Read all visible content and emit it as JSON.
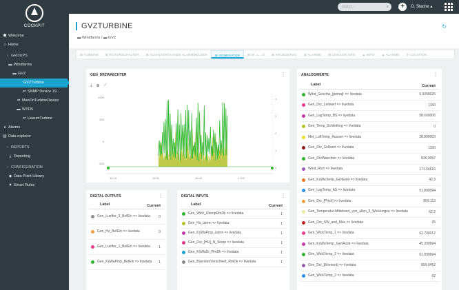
{
  "app": {
    "logo": "COCKPIT"
  },
  "sidebar": {
    "items": [
      {
        "label": "Welcome",
        "icon": "⬢",
        "indent": 2,
        "sep": false,
        "active": false
      },
      {
        "label": "Home",
        "icon": "⌂",
        "indent": 2,
        "sep": false,
        "active": false
      },
      {
        "label": "GROUPS",
        "icon": "›",
        "indent": 6,
        "sep": true,
        "active": false
      },
      {
        "label": "Windfarms",
        "icon": "▬",
        "indent": 10,
        "sep": false,
        "active": false
      },
      {
        "label": "GVZ",
        "icon": "▬",
        "indent": 16,
        "sep": false,
        "active": false
      },
      {
        "label": "GVZTurbine",
        "icon": "",
        "indent": 34,
        "sep": false,
        "active": true
      },
      {
        "label": "SNMP Device 19...",
        "icon": "⇌",
        "indent": 30,
        "sep": false,
        "active": false
      },
      {
        "label": "ManOnTurbineDevice",
        "icon": "⇌",
        "indent": 22,
        "sep": false,
        "active": false
      },
      {
        "label": "WTFN",
        "icon": "▬",
        "indent": 22,
        "sep": false,
        "active": false
      },
      {
        "label": "HasumTurbine",
        "icon": "⇌",
        "indent": 30,
        "sep": false,
        "active": false
      },
      {
        "label": "Alarms",
        "icon": "♦",
        "indent": 2,
        "sep": false,
        "active": false
      },
      {
        "label": "Data explorer",
        "icon": "▥",
        "indent": 2,
        "sep": false,
        "active": false
      },
      {
        "label": "REPORTS",
        "icon": "›",
        "indent": 6,
        "sep": true,
        "active": false
      },
      {
        "label": "Reporting",
        "icon": "⤓",
        "indent": 10,
        "sep": false,
        "active": false
      },
      {
        "label": "CONFIGURATION",
        "icon": "›",
        "indent": 6,
        "sep": true,
        "active": false
      },
      {
        "label": "Data Point Library",
        "icon": "◆",
        "indent": 10,
        "sep": false,
        "active": false
      },
      {
        "label": "Smart Rules",
        "icon": "✷",
        "indent": 10,
        "sep": false,
        "active": false
      }
    ]
  },
  "topbar": {
    "search_placeholder": "search...",
    "search_icon": "⌕",
    "add_icon": "+",
    "user": "O. Stache ▴",
    "colors": {
      "bar": "#2f3b40",
      "accent": "#19a3cf"
    }
  },
  "header": {
    "title": "GVZTURBINE",
    "crumb": "▬ Windfarms / ▬ GVZ",
    "refresh_icon": "↻"
  },
  "tabs": [
    "⊞ TURBINE",
    "⊞ ROTORSCHALTER",
    "⊞ SCHALTERSTANDE ALARMMELDER",
    "⊞ GENERATOR",
    "⊞ W...L...O",
    "⊞ KRUEGERSG",
    "⊞ ALARME",
    "⊞ LEXIKON SITE",
    "▲ INFO",
    "▲ ALARME",
    "⚲ LOCATION"
  ],
  "active_tab": 3,
  "chart_panel": {
    "title": "GEN_DRZWAECHTER",
    "kebab": "⋮",
    "tools": [
      "⤓",
      "⊕",
      "⟋"
    ],
    "yticks": [
      "1000",
      "500",
      "0",
      "-500"
    ],
    "xticks": [
      "16:15",
      "16:30",
      "16:45",
      "17:00"
    ],
    "y2ticks": [
      "4",
      "3",
      "2",
      "1",
      "0"
    ]
  },
  "chart_data": {
    "type": "area",
    "series": [
      {
        "color": "#2db52d",
        "values": [
          0,
          0,
          0,
          0,
          0,
          0,
          0,
          0,
          0,
          0,
          0,
          0,
          0,
          0,
          0,
          0,
          0,
          0,
          0,
          0,
          0,
          0,
          0,
          0,
          0,
          0,
          0,
          0,
          0,
          0,
          0,
          0,
          0,
          0,
          0,
          0,
          0,
          0,
          0,
          0,
          0,
          0,
          0,
          0,
          0,
          0,
          0,
          0,
          0,
          0,
          0,
          0,
          0,
          0,
          0,
          0,
          0,
          0,
          0,
          0,
          0,
          0,
          0,
          0,
          0,
          0,
          0,
          0,
          0,
          0,
          0,
          0,
          0,
          0,
          0,
          0,
          0,
          0,
          0,
          0,
          0,
          0,
          0,
          0,
          0,
          0,
          0,
          0,
          0,
          0
        ]
      },
      {
        "color": "#b5c12a",
        "values": [
          0,
          0,
          0,
          0,
          0,
          0,
          0,
          0,
          0,
          0,
          0,
          0,
          0,
          0,
          0,
          0,
          0,
          0,
          0,
          0,
          0,
          0,
          0,
          0,
          0,
          0,
          0,
          0,
          0,
          0,
          0,
          0,
          0,
          0,
          0,
          0,
          0,
          0,
          0,
          0,
          0,
          0,
          0,
          0,
          0,
          0,
          0,
          0,
          0,
          0,
          0,
          0,
          0,
          0,
          0,
          0,
          0,
          0,
          0,
          0,
          0,
          0,
          0,
          0,
          0,
          0,
          0,
          0,
          0,
          0,
          0,
          0,
          0,
          0,
          0,
          0,
          0,
          0,
          0,
          0,
          0,
          0,
          0,
          0,
          0,
          0,
          0,
          0,
          0,
          0
        ]
      }
    ]
  },
  "analog": {
    "title": "ANALOGWERTE",
    "kebab": "⋮",
    "col_label": "Label",
    "col_current": "Current",
    "rows": [
      {
        "label": "Wind_Geschw_[prima]r => livedata",
        "value": "6.6058025",
        "color": "#2db52d"
      },
      {
        "label": "Gen_Drz_Leitwert => livedata",
        "value": "1160",
        "color": "#e83a8a"
      },
      {
        "label": "Gen_LagTemp_BS => livedata",
        "value": "58.600006",
        "color": "#c03aa8"
      },
      {
        "label": "Gen_Temp_Schleifring => livedata",
        "value": "0",
        "color": "#b5c12a"
      },
      {
        "label": "Met_LuftTemp_Aussen => livedata",
        "value": "28.800003",
        "color": "#e8e02a"
      },
      {
        "label": "Gen_Drz_Sollwert => livedata",
        "value": "1160",
        "color": "#8a1a1a"
      },
      {
        "label": "Gen_DrzWaechter => livedata",
        "value": "836.9057",
        "color": "#2db52d"
      },
      {
        "label": "Wind_Rich => livedata",
        "value": "171.04616",
        "color": "#9b59b6"
      },
      {
        "label": "Gen_KüWaTemp_GenEintr => livedata",
        "value": "42.3",
        "color": "#e8782a"
      },
      {
        "label": "Gen_LagTemp_AS => livedata",
        "value": "51.899994",
        "color": "#2a8de8"
      },
      {
        "label": "Gen_Drz_[Pitch] => livedata",
        "value": "859.113",
        "color": "#f0a040"
      },
      {
        "label": "Gen_Temperatur-Mittelwert_von_allen_3_Wicklungen => livedata",
        "value": "62.2",
        "color": "#e8e8a0"
      },
      {
        "label": "Gen_Drz_SW_and_Max => livedata",
        "value": "25",
        "color": "#c02a2a"
      },
      {
        "label": "Gen_WickTemp_1 => livedata",
        "value": "62.700012",
        "color": "#e83a8a"
      },
      {
        "label": "Gen_KüWaTemp_GenAustr => livedata",
        "value": "45.399994",
        "color": "#c03aa8"
      },
      {
        "label": "Gen_WickTemp_2 => livedata",
        "value": "61.899994",
        "color": "#2db52d"
      },
      {
        "label": "Gen_Drz_[Moment] => livedata",
        "value": "859.0452",
        "color": "#9b59b6"
      },
      {
        "label": "Gen_WickTemp_3 => livedata",
        "value": "62",
        "color": "#2a8de8"
      }
    ]
  },
  "digital_outputs": {
    "title": "DIGITAL OUTPUTS",
    "kebab": "⋮",
    "col_label": "Label",
    "col_current": "Current",
    "rows": [
      {
        "label": "Gen_Luefter_2_BefEin => livedata",
        "value": "0",
        "color": "#8a8a8a"
      },
      {
        "label": "Gen_Hz_BefEin => livedata",
        "value": "0",
        "color": "#f0a040"
      },
      {
        "label": "Gen_Luefter_1_BefEin => livedata",
        "value": "1",
        "color": "#e83a8a"
      },
      {
        "label": "Gen_KüWaPmp_BefEin => livedata",
        "value": "1",
        "color": "#2db52d"
      }
    ]
  },
  "digital_inputs": {
    "title": "DIGITAL INPUTS",
    "kebab": "⋮",
    "col_label": "Label",
    "col_current": "Current",
    "rows": [
      {
        "label": "Gen_Wick_ÜtempRmDk => livedata",
        "value": "1",
        "color": "#2db52d"
      },
      {
        "label": "Gen_Hz_üstrm => livedata",
        "value": "1",
        "color": "#b5c12a"
      },
      {
        "label": "Gen_KüWaPmp_üstrm => livedata",
        "value": "1",
        "color": "#c03aa8"
      },
      {
        "label": "Gen_Drz_[HU]_N_Stopp => livedata",
        "value": "1",
        "color": "#e83a8a"
      },
      {
        "label": "Gen_KüWaDr_RmDk => livedata",
        "value": "1",
        "color": "#19a3cf"
      },
      {
        "label": "Gen_BuerstenVerschleiß_RmDk => livedata",
        "value": "1",
        "color": "#8a8a8a"
      }
    ]
  }
}
